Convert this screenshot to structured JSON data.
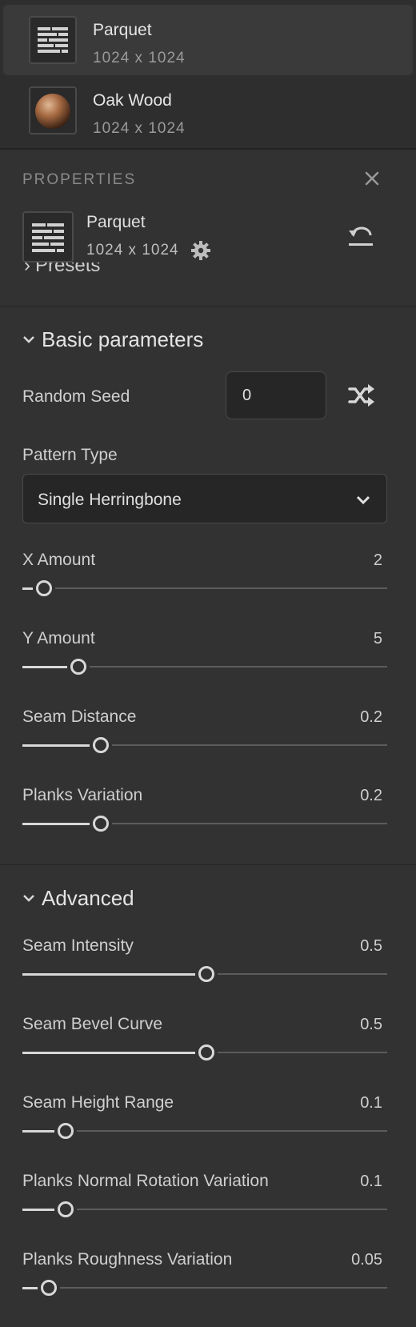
{
  "materials": [
    {
      "name": "Parquet",
      "size": "1024 x 1024",
      "icon": "parquet-thumbnail",
      "selected": true
    },
    {
      "name": "Oak Wood",
      "size": "1024 x 1024",
      "icon": "wood-sphere-thumbnail",
      "selected": false
    }
  ],
  "properties": {
    "title": "PROPERTIES",
    "material_name": "Parquet",
    "material_size": "1024 x 1024",
    "presets_label": "Presets"
  },
  "basic": {
    "title": "Basic parameters",
    "random_seed_label": "Random Seed",
    "random_seed_value": "0",
    "pattern_type_label": "Pattern Type",
    "pattern_type_value": "Single Herringbone",
    "sliders": [
      {
        "label": "X Amount",
        "value": "2",
        "fraction": 0.055
      },
      {
        "label": "Y Amount",
        "value": "5",
        "fraction": 0.15
      },
      {
        "label": "Seam Distance",
        "value": "0.2",
        "fraction": 0.21
      },
      {
        "label": "Planks Variation",
        "value": "0.2",
        "fraction": 0.21
      }
    ]
  },
  "advanced": {
    "title": "Advanced",
    "sliders": [
      {
        "label": "Seam Intensity",
        "value": "0.5",
        "fraction": 0.5
      },
      {
        "label": "Seam Bevel Curve",
        "value": "0.5",
        "fraction": 0.5
      },
      {
        "label": "Seam Height Range",
        "value": "0.1",
        "fraction": 0.115
      },
      {
        "label": "Planks Normal Rotation Variation",
        "value": "0.1",
        "fraction": 0.115
      },
      {
        "label": "Planks Roughness Variation",
        "value": "0.05",
        "fraction": 0.068
      }
    ]
  },
  "colors": {
    "background": "#323232",
    "accent": "#d8d8d8"
  }
}
